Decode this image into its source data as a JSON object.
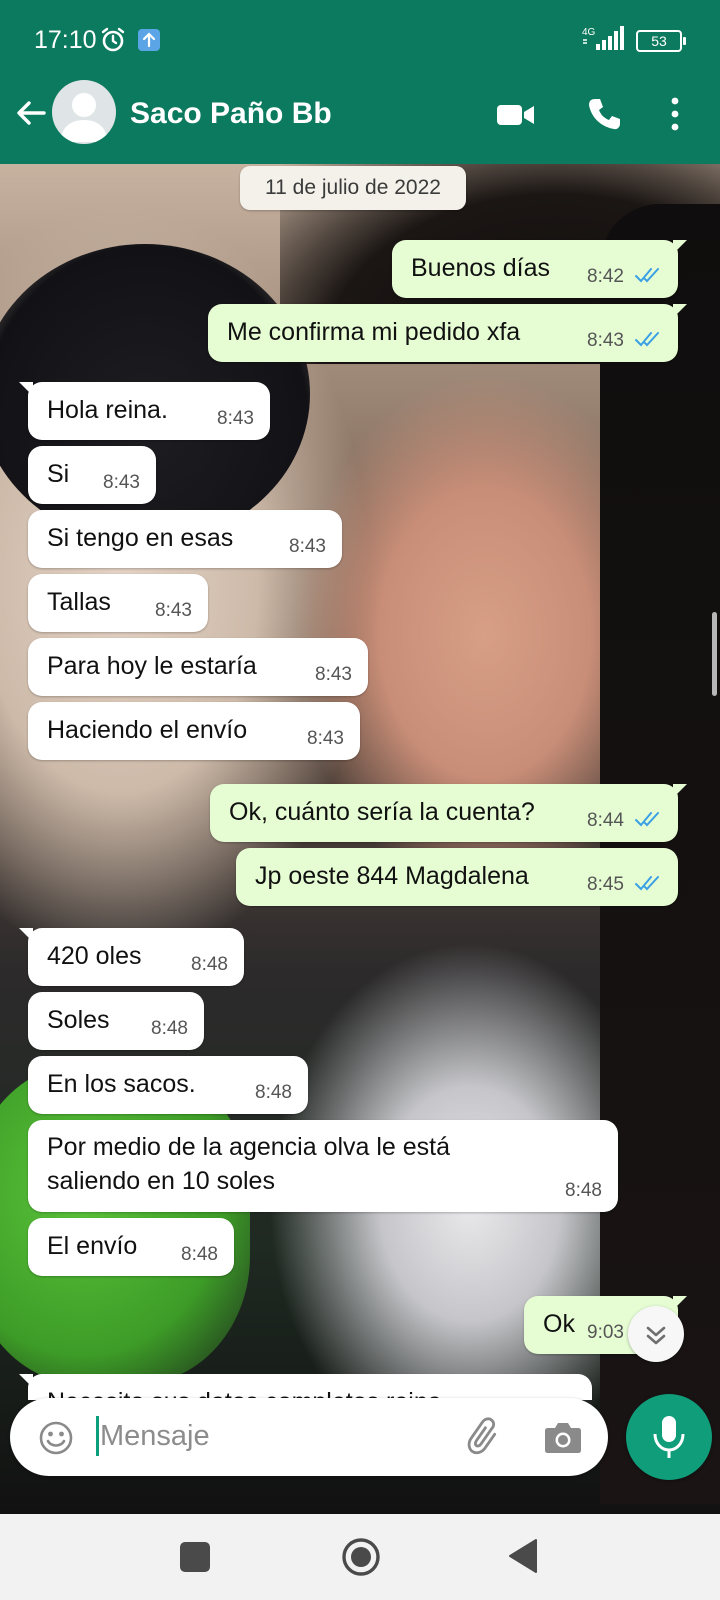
{
  "status_bar": {
    "time": "17:10",
    "network": "4G",
    "battery": "53"
  },
  "header": {
    "contact_name": "Saco Paño Bb"
  },
  "chat": {
    "date": "11 de julio de 2022",
    "messages": [
      {
        "dir": "out",
        "text": "Buenos días",
        "time": "8:42"
      },
      {
        "dir": "out",
        "text": "Me confirma mi pedido xfa",
        "time": "8:43"
      },
      {
        "dir": "in",
        "text": "Hola reina.",
        "time": "8:43"
      },
      {
        "dir": "in",
        "text": "Si",
        "time": "8:43"
      },
      {
        "dir": "in",
        "text": "Si tengo en esas",
        "time": "8:43"
      },
      {
        "dir": "in",
        "text": "Tallas",
        "time": "8:43"
      },
      {
        "dir": "in",
        "text": "Para hoy le estaría",
        "time": "8:43"
      },
      {
        "dir": "in",
        "text": "Haciendo el envío",
        "time": "8:43"
      },
      {
        "dir": "out",
        "text": "Ok, cuánto sería la cuenta?",
        "time": "8:44"
      },
      {
        "dir": "out",
        "text": "Jp oeste 844 Magdalena",
        "time": "8:45"
      },
      {
        "dir": "in",
        "text": "420 oles",
        "time": "8:48"
      },
      {
        "dir": "in",
        "text": "Soles",
        "time": "8:48"
      },
      {
        "dir": "in",
        "text": "En los sacos.",
        "time": "8:48"
      },
      {
        "dir": "in",
        "text": "Por medio de la agencia olva le está saliendo en 10 soles",
        "time": "8:48"
      },
      {
        "dir": "in",
        "text": "El envío",
        "time": "8:48"
      },
      {
        "dir": "out",
        "text": "Ok",
        "time": "9:03"
      },
      {
        "dir": "in",
        "text": "Necesito sus datos completos reina",
        "time": ""
      }
    ]
  },
  "composer": {
    "placeholder": "Mensaje"
  },
  "colors": {
    "header": "#0c7a5e",
    "outgoing_bubble": "#e6fdd4",
    "incoming_bubble": "#ffffff",
    "read_ticks": "#3aa0e4",
    "mic_button": "#0f9d7a"
  },
  "icons": [
    "back-arrow-icon",
    "avatar-icon",
    "video-call-icon",
    "phone-call-icon",
    "more-options-icon",
    "emoji-icon",
    "attach-icon",
    "camera-icon",
    "mic-icon",
    "scroll-down-icon"
  ]
}
